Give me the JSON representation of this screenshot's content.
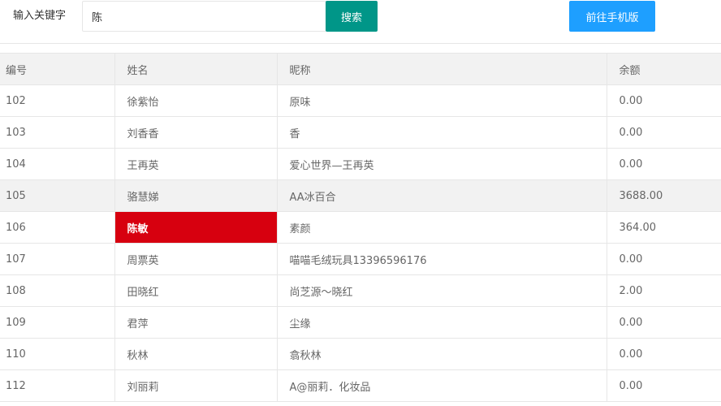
{
  "search": {
    "label": "输入关键字",
    "value": "陈",
    "button": "搜索",
    "mobile_button": "前往手机版"
  },
  "colors": {
    "search_button": "#009688",
    "mobile_button": "#1e9fff",
    "highlight": "#d7000f",
    "header_bg": "#f2f2f2"
  },
  "table": {
    "headers": [
      "编号",
      "姓名",
      "昵称",
      "余额"
    ],
    "rows": [
      [
        "102",
        "徐紫怡",
        "原味",
        "0.00"
      ],
      [
        "103",
        "刘香香",
        "香",
        "0.00"
      ],
      [
        "104",
        "王再英",
        "爱心世界—王再英",
        "0.00"
      ],
      [
        "105",
        "骆慧娣",
        "AA冰百合",
        "3688.00"
      ],
      [
        "106",
        "陈敏",
        "素颜",
        "364.00"
      ],
      [
        "107",
        "周票英",
        "喵喵毛绒玩具13396596176",
        "0.00"
      ],
      [
        "108",
        "田晓红",
        "尚芝源～晓红",
        "2.00"
      ],
      [
        "109",
        "君萍",
        "尘缘",
        "0.00"
      ],
      [
        "110",
        "秋林",
        "翕秋林",
        "0.00"
      ],
      [
        "112",
        "刘丽莉",
        "A@丽莉．化妆品",
        "0.00"
      ]
    ]
  }
}
